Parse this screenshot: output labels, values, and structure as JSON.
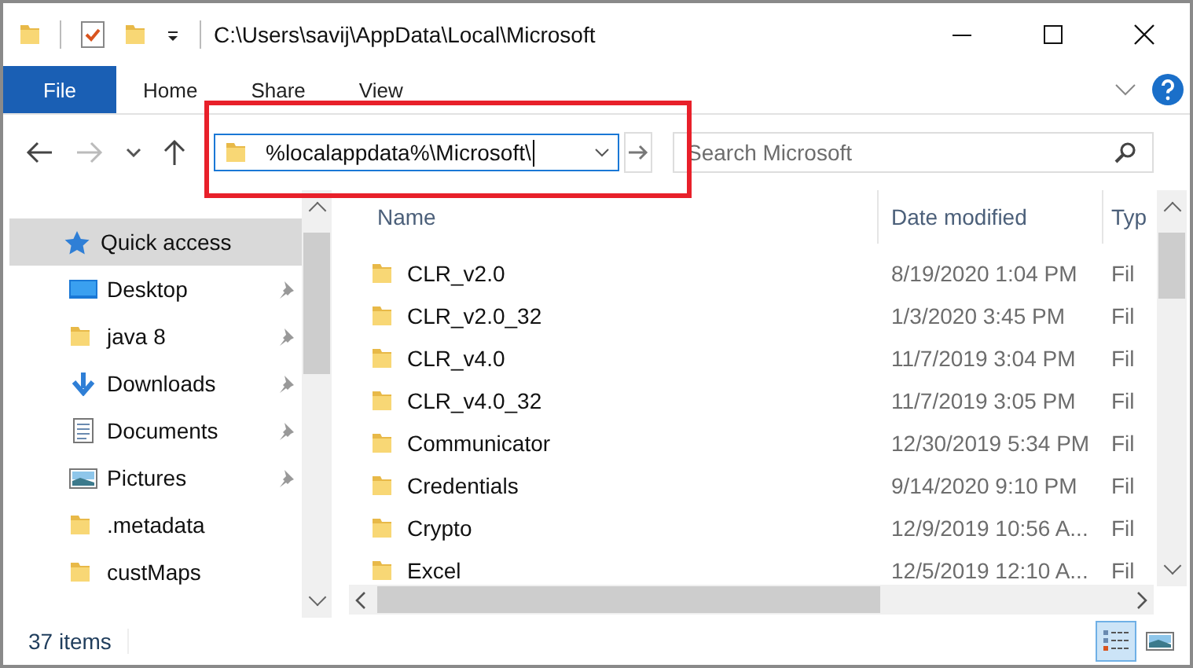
{
  "window": {
    "title": "C:\\Users\\savij\\AppData\\Local\\Microsoft"
  },
  "ribbon_tabs": [
    {
      "label": "File",
      "selected": true
    },
    {
      "label": "Home",
      "selected": false
    },
    {
      "label": "Share",
      "selected": false
    },
    {
      "label": "View",
      "selected": false
    }
  ],
  "address_bar": {
    "value": "%localappdata%\\Microsoft\\"
  },
  "search": {
    "placeholder": "Search Microsoft"
  },
  "sidebar": {
    "items": [
      {
        "label": "Quick access",
        "kind": "star",
        "pinned": false,
        "selected": true
      },
      {
        "label": "Desktop",
        "kind": "desktop",
        "pinned": true,
        "selected": false
      },
      {
        "label": "java 8",
        "kind": "folder",
        "pinned": true,
        "selected": false
      },
      {
        "label": "Downloads",
        "kind": "download",
        "pinned": true,
        "selected": false
      },
      {
        "label": "Documents",
        "kind": "documents",
        "pinned": true,
        "selected": false
      },
      {
        "label": "Pictures",
        "kind": "pictures",
        "pinned": true,
        "selected": false
      },
      {
        "label": ".metadata",
        "kind": "folder",
        "pinned": false,
        "selected": false
      },
      {
        "label": "custMaps",
        "kind": "folder",
        "pinned": false,
        "selected": false
      }
    ]
  },
  "table": {
    "columns": [
      "Name",
      "Date modified",
      "Typ"
    ],
    "rows": [
      [
        "CLR_v2.0",
        "8/19/2020 1:04 PM",
        "Fil"
      ],
      [
        "CLR_v2.0_32",
        "1/3/2020 3:45 PM",
        "Fil"
      ],
      [
        "CLR_v4.0",
        "11/7/2019 3:04 PM",
        "Fil"
      ],
      [
        "CLR_v4.0_32",
        "11/7/2019 3:05 PM",
        "Fil"
      ],
      [
        "Communicator",
        "12/30/2019 5:34 PM",
        "Fil"
      ],
      [
        "Credentials",
        "9/14/2020 9:10 PM",
        "Fil"
      ],
      [
        "Crypto",
        "12/9/2019 10:56 A...",
        "Fil"
      ],
      [
        "Excel",
        "12/5/2019 12:10 A...",
        "Fil"
      ]
    ]
  },
  "status_bar": {
    "count": "37 items",
    "views": [
      {
        "kind": "details",
        "selected": true
      },
      {
        "kind": "tiles",
        "selected": false
      }
    ]
  }
}
